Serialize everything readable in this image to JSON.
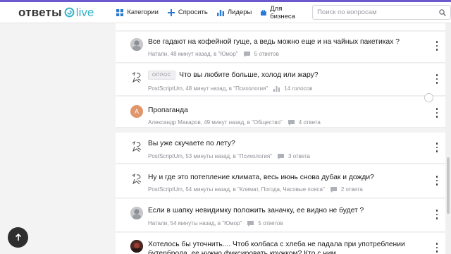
{
  "header": {
    "logo_left": "ответы",
    "logo_right": "live",
    "nav": [
      {
        "label": "Категории",
        "icon": "grid-icon"
      },
      {
        "label": "Спросить",
        "icon": "plus-icon"
      },
      {
        "label": "Лидеры",
        "icon": "bar-chart-icon"
      },
      {
        "label": "Для бизнеса",
        "icon": "briefcase-icon"
      }
    ],
    "search_placeholder": "Поиск по вопросам",
    "accent_color": "#6a5acd",
    "nav_icon_color": "#2a7ad4"
  },
  "questions": [
    {
      "title": "Все гадают на кофейной гуще, а ведь можно еще и на чайных пакетиках ?",
      "author": "Натали",
      "time": "48 минут назад",
      "category_prefix": "в",
      "category": "\"Юмор\"",
      "stat": "5 ответов",
      "stat_icon": "comment-icon",
      "avatar": "photo-avatar"
    },
    {
      "badge": "ОПРОС",
      "title": "Что вы любите больше, холод или жару?",
      "author": "PostScriptUm",
      "time": "48 минут назад",
      "category_prefix": "в",
      "category": "\"Психология\"",
      "stat": "14 голосов",
      "stat_icon": "bar-chart-icon",
      "avatar": "sketch-avatar"
    },
    {
      "title": "Пропаганда",
      "author": "Александр Макаров",
      "time": "49 минут назад",
      "category_prefix": "в",
      "category": "\"Общество\"",
      "stat": "4 ответа",
      "stat_icon": "comment-icon",
      "avatar": "letter-avatar",
      "avatar_letter": "А",
      "avatar_color": "#e0966a"
    },
    {
      "title": "Вы уже скучаете по лету?",
      "author": "PostScriptUm",
      "time": "53 минуты назад",
      "category_prefix": "в",
      "category": "\"Психология\"",
      "stat": "3 ответа",
      "stat_icon": "comment-icon",
      "avatar": "sketch-avatar"
    },
    {
      "title": "Ну и где это потепление климата, весь июнь снова дубак и дожди?",
      "author": "PostScriptUm",
      "time": "54 минуты назад",
      "category_prefix": "в",
      "category": "\"Климат, Погода, Часовые пояса\"",
      "stat": "2 ответа",
      "stat_icon": "comment-icon",
      "avatar": "sketch-avatar"
    },
    {
      "title": "Если в шапку невидимку положить заначку, ее видно не будет ?",
      "author": "Натали",
      "time": "54 минуты назад",
      "category_prefix": "в",
      "category": "\"Юмор\"",
      "stat": "5 ответов",
      "stat_icon": "comment-icon",
      "avatar": "photo-avatar"
    },
    {
      "title": "Хотелось бы уточнить.... Чтоб колбаса с хлеба не падала при употреблении бутерброда, ее нужно фиксировать кружком? Кто с ним ...",
      "avatar": "photo-avatar-dark"
    }
  ]
}
